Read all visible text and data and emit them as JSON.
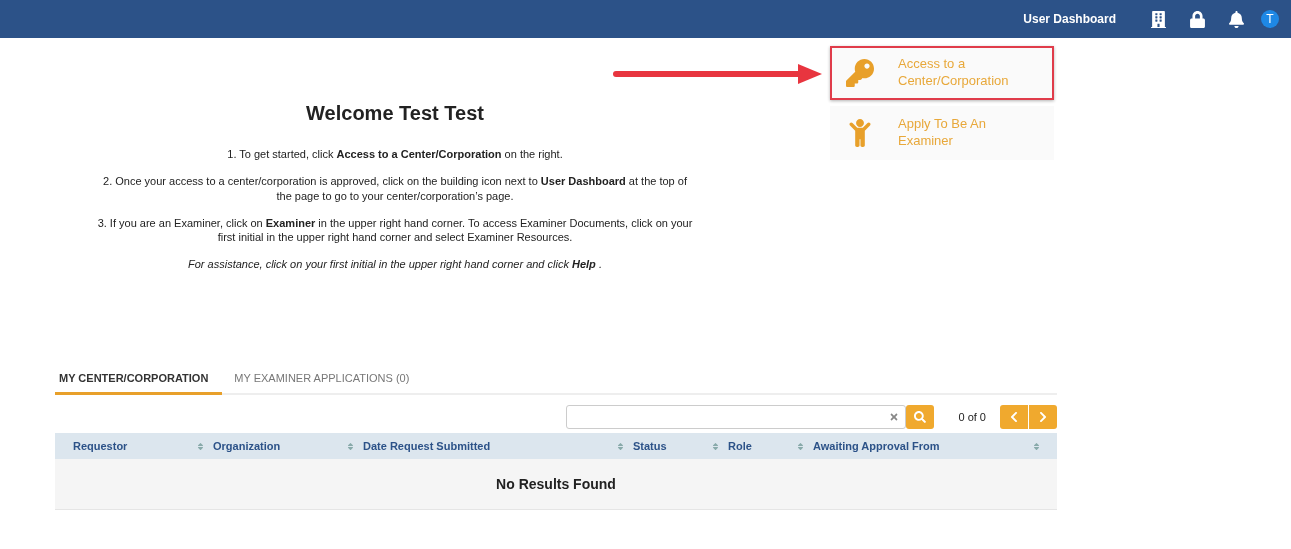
{
  "header": {
    "title": "User Dashboard",
    "avatar_initial": "T"
  },
  "welcome": {
    "title": "Welcome Test Test",
    "paragraphs": [
      {
        "kind": "step",
        "text": "1. To get started, click **Access to a Center/Corporation** on the right."
      },
      {
        "kind": "step",
        "text": "2. Once your access to a center/corporation is approved, click on the building icon next to **User Dashboard** at the top of the page to go to your center/corporation’s page."
      },
      {
        "kind": "step",
        "text": "3. If you are an Examiner, click on **Examiner** in the upper right hand corner. To access Examiner Documents, click on your first initial in the upper right hand corner and select Examiner Resources."
      },
      {
        "kind": "note",
        "text": "For assistance, click on your first initial in the upper right hand corner and click **Help** ."
      }
    ]
  },
  "actions": [
    {
      "kind": "key",
      "label": "Access to a Center/Corporation",
      "highlighted": true
    },
    {
      "kind": "person",
      "label": "Apply To Be An Examiner",
      "highlighted": false
    }
  ],
  "tabs": [
    {
      "label": "MY CENTER/CORPORATION",
      "selected": true
    },
    {
      "label": "MY EXAMINER APPLICATIONS (0)",
      "selected": false
    }
  ],
  "pager": "0 of 0",
  "table": {
    "columns": [
      "Requestor",
      "Organization",
      "Date Request Submitted",
      "Status",
      "Role",
      "Awaiting Approval From"
    ],
    "empty_message": "No Results Found"
  }
}
